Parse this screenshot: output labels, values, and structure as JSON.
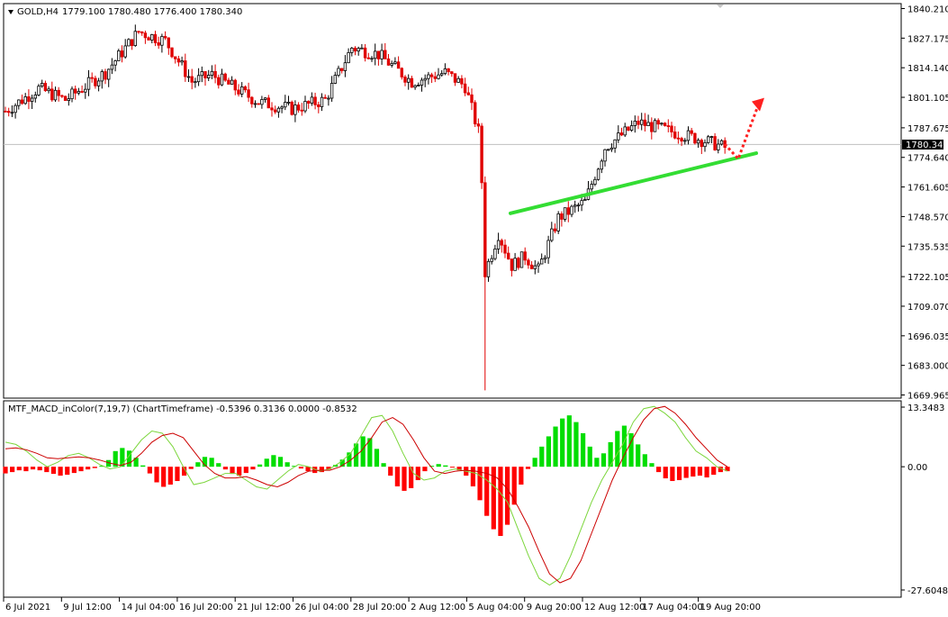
{
  "header": {
    "symbol": "GOLD,H4",
    "ohlc": "1779.100 1780.480 1776.400 1780.340"
  },
  "current_price": "1780.340",
  "indicator": {
    "title": "MTF_MACD_inColor(7,19,7) (ChartTimeframe) -0.5396 0.3136 0.0000 -0.8532"
  },
  "colors": {
    "bull_candle": "#000000",
    "bear_candle": "#e00000",
    "trendline": "#33dd33",
    "arrow": "#ff2020",
    "hist_pos": "#00dd00",
    "hist_neg": "#ff0000",
    "macd_line": "#7cd63c",
    "signal_line": "#cc0000",
    "price_line": "#c0c0c0"
  },
  "chart_data": [
    {
      "type": "candlestick",
      "symbol": "GOLD",
      "timeframe": "H4",
      "ylim": [
        1669.965,
        1840.21
      ],
      "y_ticks": [
        "1840.210",
        "1827.175",
        "1814.140",
        "1801.105",
        "1787.675",
        "1774.640",
        "1761.605",
        "1748.570",
        "1735.535",
        "1722.105",
        "1709.070",
        "1696.035",
        "1683.000",
        "1669.965"
      ],
      "x_ticks": [
        "6 Jul 2021",
        "9 Jul 12:00",
        "14 Jul 04:00",
        "16 Jul 20:00",
        "21 Jul 12:00",
        "26 Jul 04:00",
        "28 Jul 20:00",
        "2 Aug 12:00",
        "5 Aug 04:00",
        "9 Aug 20:00",
        "12 Aug 12:00",
        "17 Aug 04:00",
        "19 Aug 20:00"
      ],
      "last_close": 1780.34,
      "approx_close_path": [
        [
          0,
          1795
        ],
        [
          10,
          1805
        ],
        [
          18,
          1800
        ],
        [
          30,
          1812
        ],
        [
          40,
          1830
        ],
        [
          48,
          1826
        ],
        [
          56,
          1808
        ],
        [
          62,
          1811
        ],
        [
          76,
          1799
        ],
        [
          86,
          1796
        ],
        [
          96,
          1800
        ],
        [
          104,
          1823
        ],
        [
          112,
          1820
        ],
        [
          122,
          1808
        ],
        [
          132,
          1812
        ],
        [
          138,
          1806
        ],
        [
          140,
          1796
        ],
        [
          142,
          1786
        ],
        [
          143,
          1764
        ],
        [
          144,
          1724
        ],
        [
          148,
          1741
        ],
        [
          152,
          1727
        ],
        [
          156,
          1731
        ],
        [
          160,
          1725
        ],
        [
          166,
          1748
        ],
        [
          174,
          1755
        ],
        [
          180,
          1779
        ],
        [
          190,
          1790
        ],
        [
          200,
          1786
        ],
        [
          210,
          1782
        ],
        [
          216,
          1779
        ]
      ],
      "trendline": {
        "from": 1750.0,
        "to": 1776.5
      },
      "annotation": "dotted up-arrow projection"
    },
    {
      "type": "histogram+line",
      "name": "MTF_MACD_inColor(7,19,7)",
      "ylim": [
        -27.6048,
        13.3483
      ],
      "y_ticks": [
        "13.3483",
        "0.00",
        "-27.6048"
      ],
      "histogram": [
        -1.5,
        -1.2,
        -0.8,
        -1.0,
        -0.6,
        -0.8,
        -1.2,
        -1.6,
        -2.0,
        -1.8,
        -1.4,
        -1.0,
        -0.6,
        -0.3,
        0.2,
        1.5,
        3.5,
        4.2,
        3.6,
        2.0,
        0.3,
        -1.5,
        -3.5,
        -4.5,
        -4.0,
        -3.2,
        -2.0,
        -0.5,
        1.0,
        2.2,
        2.0,
        0.8,
        -0.6,
        -1.6,
        -2.0,
        -1.4,
        -0.6,
        0.5,
        1.8,
        2.6,
        2.2,
        1.0,
        0.2,
        -0.4,
        -1.0,
        -1.4,
        -1.2,
        -0.6,
        0.4,
        1.6,
        3.2,
        5.2,
        6.8,
        6.4,
        4.0,
        0.8,
        -2.0,
        -4.4,
        -5.4,
        -4.8,
        -3.0,
        -1.0,
        0.2,
        0.6,
        0.3,
        -0.2,
        -0.8,
        -2.0,
        -4.4,
        -7.5,
        -11.0,
        -14.0,
        -15.5,
        -13.0,
        -8.5,
        -4.0,
        -0.5,
        2.0,
        4.5,
        6.8,
        9.0,
        10.8,
        11.5,
        10.0,
        7.5,
        4.5,
        2.0,
        3.0,
        5.5,
        8.0,
        9.2,
        7.5,
        5.0,
        2.8,
        0.8,
        -1.2,
        -2.6,
        -3.2,
        -3.0,
        -2.5,
        -2.2,
        -2.0,
        -2.4,
        -1.8,
        -1.2,
        -1.0
      ],
      "macd_line": [
        5.5,
        5.0,
        3.5,
        1.5,
        0.0,
        1.0,
        2.5,
        3.0,
        2.0,
        0.5,
        -0.5,
        0.0,
        3.0,
        6.0,
        8.0,
        7.5,
        4.5,
        0.0,
        -4.0,
        -3.5,
        -2.5,
        -1.5,
        -1.5,
        -3.0,
        -4.5,
        -5.0,
        -3.0,
        -1.0,
        0.5,
        0.0,
        -1.0,
        -0.5,
        1.0,
        3.0,
        7.0,
        11.0,
        11.5,
        8.0,
        3.0,
        -1.5,
        -3.0,
        -2.5,
        -1.0,
        -0.5,
        -1.0,
        -1.5,
        -3.0,
        -5.0,
        -8.0,
        -14.0,
        -20.0,
        -25.0,
        -26.5,
        -25.0,
        -20.0,
        -14.0,
        -8.0,
        -3.0,
        1.0,
        5.0,
        10.0,
        13.0,
        13.5,
        12.0,
        10.0,
        6.5,
        3.5,
        2.0,
        0.0,
        -1.0
      ],
      "signal_line": [
        4.0,
        4.2,
        3.8,
        3.0,
        2.0,
        1.8,
        2.0,
        2.2,
        2.0,
        1.5,
        0.8,
        0.3,
        1.0,
        3.0,
        5.5,
        7.0,
        7.5,
        6.5,
        3.5,
        0.5,
        -1.5,
        -2.5,
        -2.5,
        -2.2,
        -3.0,
        -4.0,
        -4.5,
        -3.5,
        -2.0,
        -1.0,
        -0.8,
        -0.8,
        0.0,
        1.5,
        3.5,
        6.5,
        10.0,
        11.0,
        9.5,
        6.0,
        2.0,
        -1.0,
        -1.5,
        -1.0,
        -0.8,
        -1.0,
        -1.5,
        -2.5,
        -5.0,
        -9.0,
        -13.5,
        -19.0,
        -24.0,
        -26.0,
        -25.0,
        -21.0,
        -15.0,
        -9.0,
        -3.0,
        2.0,
        6.5,
        10.5,
        13.0,
        13.5,
        12.0,
        9.5,
        6.5,
        4.0,
        1.5,
        0.0
      ]
    }
  ]
}
